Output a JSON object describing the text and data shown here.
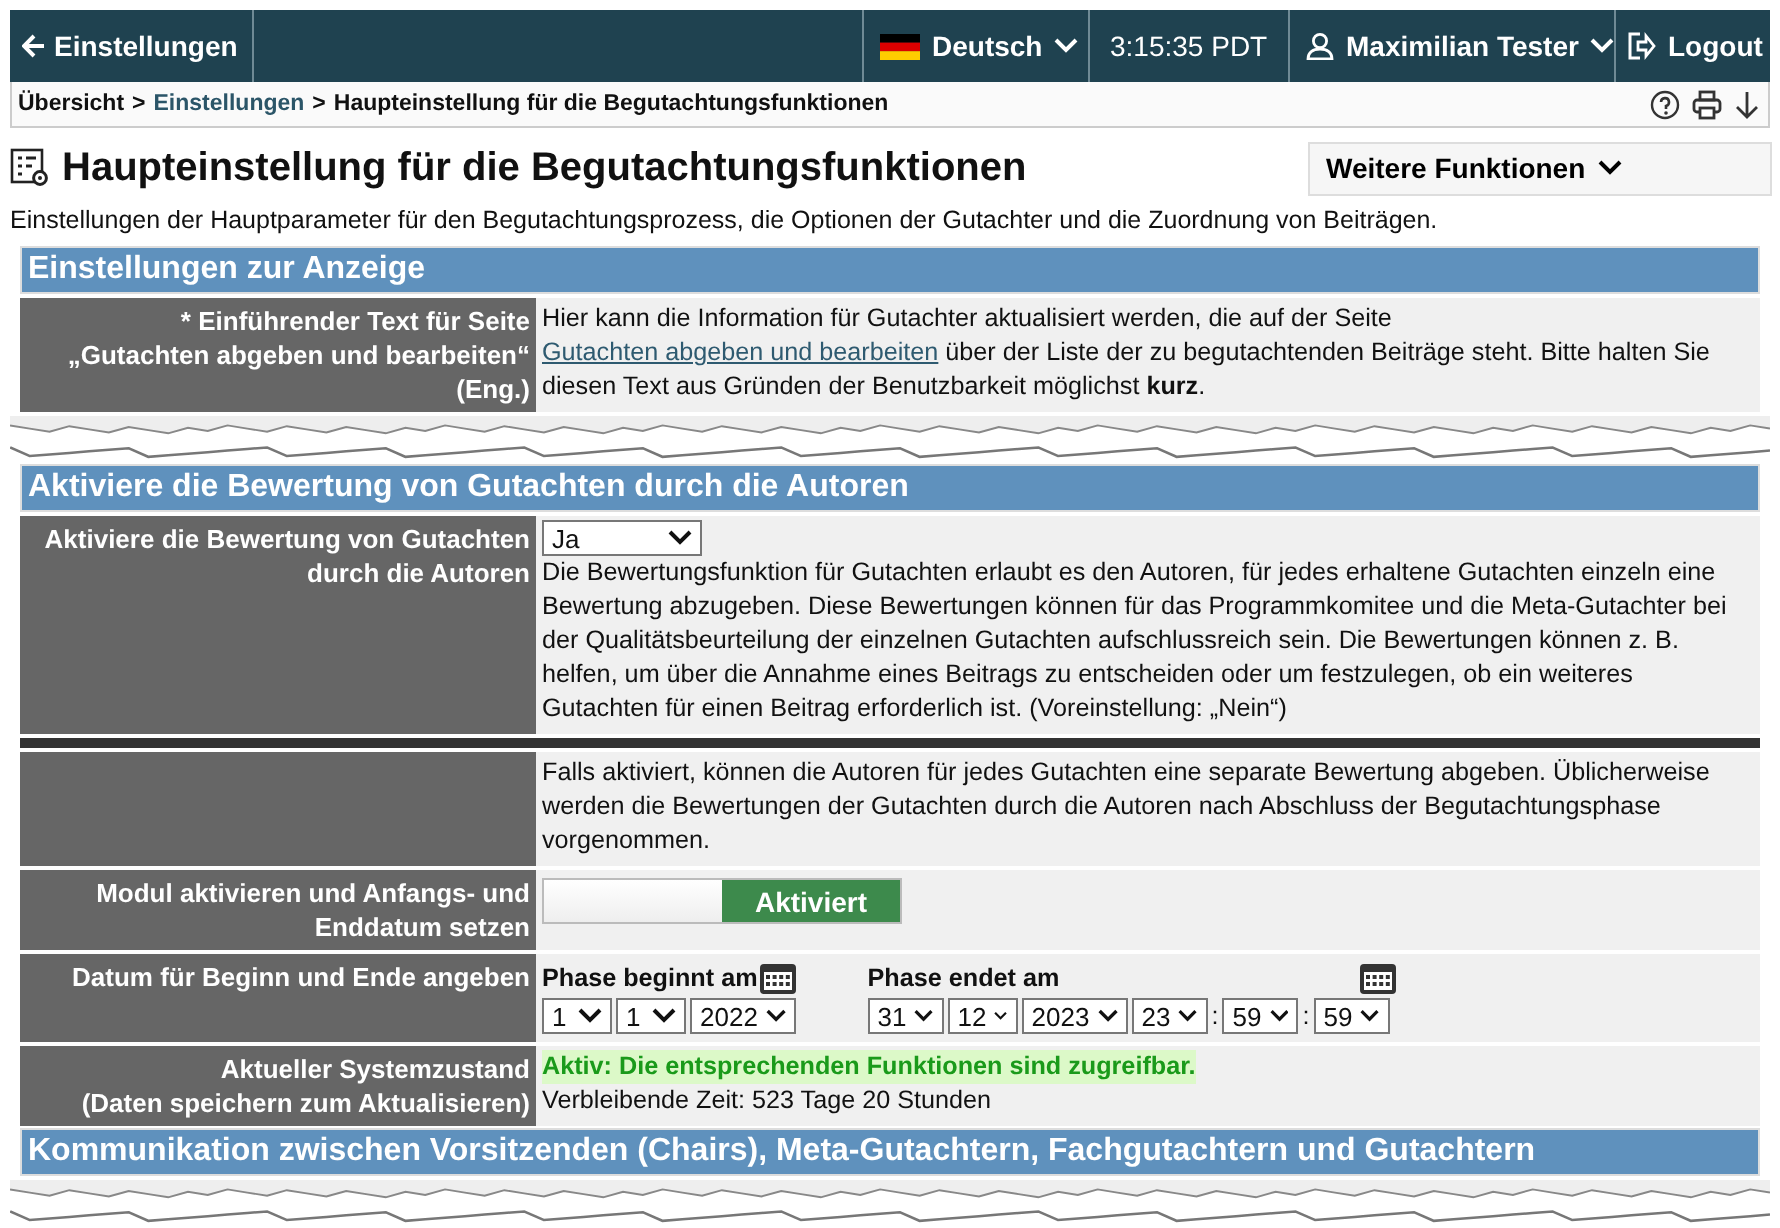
{
  "topbar": {
    "back": "Einstellungen",
    "language": "Deutsch",
    "time": "3:15:35 PDT",
    "user": "Maximilian Tester",
    "logout": "Logout"
  },
  "breadcrumb": [
    {
      "kind": "text",
      "text": "Übersicht"
    },
    {
      "kind": "separator",
      "text": ">"
    },
    {
      "kind": "link",
      "text": "Einstellungen"
    },
    {
      "kind": "separator",
      "text": ">"
    },
    {
      "kind": "text",
      "text": "Haupteinstellung für die Begutachtungsfunktionen"
    }
  ],
  "title": "Haupteinstellung für die Begutachtungsfunktionen",
  "more_button": "Weitere Funktionen",
  "description": "Einstellungen der Hauptparameter für den Begutachtungsprozess, die Optionen der Gutachter und die Zuordnung von Beiträgen.",
  "blocks": [
    {
      "kind": "section",
      "title": "Einstellungen zur Anzeige"
    },
    {
      "kind": "text",
      "label": "* Einführender Text für Seite\n„Gutachten abgeben und bearbeiten“\n(Eng.)",
      "parts": [
        {
          "text": "Hier kann die Information für Gutachter aktualisiert werden, die auf der Seite ",
          "link": false
        },
        {
          "text": "Gutachten abgeben und bearbeiten",
          "link": true
        },
        {
          "text": " über der Liste der zu begutachtenden Beiträge steht. Bitte halten Sie diesen Text aus Gründen der Benutzbarkeit möglichst **kurz**.",
          "link": false
        }
      ]
    },
    {
      "kind": "tear"
    },
    {
      "kind": "section",
      "title": "Aktiviere die Bewertung von Gutachten durch die Autoren"
    },
    {
      "kind": "select",
      "label": "Aktiviere die Bewertung von Gutachten durch die Autoren",
      "value": "Ja",
      "text": "Die Bewertungsfunktion für Gutachten erlaubt es den Autoren, für jedes erhaltene Gutachten einzeln eine Bewertung abzugeben. Diese Bewertungen können für das Programmkomitee und die Meta-Gutachter bei der Qualitätsbeurteilung der einzelnen Gutachten aufschlussreich sein. Die Bewertungen können z. B. helfen, um über die Annahme eines Beitrags zu entscheiden oder um festzulegen, ob ein weiteres Gutachten für einen Beitrag erforderlich ist. (Voreinstellung: „Nein“)"
    },
    {
      "kind": "divider"
    },
    {
      "kind": "text",
      "parts": [
        {
          "text": "Falls aktiviert, können die Autoren für jedes Gutachten eine separate Bewertung abgeben. Üblicherweise werden die Bewertungen der Gutachten durch die Autoren nach Abschluss der Begutachtungsphase vorgenommen.",
          "link": false
        }
      ]
    },
    {
      "kind": "toggle",
      "label": "Modul aktivieren und Anfangs- und Enddatum setzen",
      "toggle_label": "Aktiviert",
      "on": true
    },
    {
      "kind": "dates",
      "label": "Datum für Beginn und Ende angeben",
      "start": {
        "label": "Phase beginnt am",
        "fields": [
          "1",
          "1",
          "2022"
        ]
      },
      "end": {
        "label": "Phase endet am",
        "fields": [
          "31",
          "12",
          "2023"
        ],
        "time": [
          "23",
          "59",
          "59"
        ],
        "separators": [
          ":",
          ":"
        ]
      }
    },
    {
      "kind": "status",
      "label": "Aktueller Systemzustand\n(Daten speichern zum Aktualisieren)",
      "status": "Aktiv: Die entsprechenden Funktionen sind zugreifbar.",
      "remaining": "Verbleibende Zeit: 523 Tage 20 Stunden"
    },
    {
      "kind": "section",
      "title": "Kommunikation zwischen Vorsitzenden (Chairs), Meta-Gutachtern, Fachgutachtern und Gutachtern"
    },
    {
      "kind": "tear"
    }
  ]
}
